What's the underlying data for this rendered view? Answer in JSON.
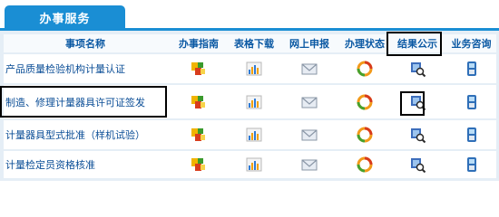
{
  "tab": {
    "label": "办事服务"
  },
  "table": {
    "headers": [
      "事项名称",
      "办事指南",
      "表格下载",
      "网上申报",
      "办理状态",
      "结果公示",
      "业务咨询"
    ],
    "rows": [
      {
        "name": "产品质量检验机构计量认证"
      },
      {
        "name": "制造、修理计量器具许可证签发"
      },
      {
        "name": "计量器具型式批准（样机试验）"
      },
      {
        "name": "计量检定员资格核准"
      }
    ],
    "icons": [
      "guide-icon",
      "chart-icon",
      "envelope-icon",
      "status-icon",
      "result-icon",
      "phone-icon"
    ]
  },
  "highlights": [
    "结果公示",
    "制造、修理计量器具许可证签发",
    "result-icon"
  ],
  "colors": {
    "tab": "#1a8ed4",
    "header_text": "#0a58a3",
    "row_text": "#0a4d96",
    "grid": "#e5eef6"
  }
}
